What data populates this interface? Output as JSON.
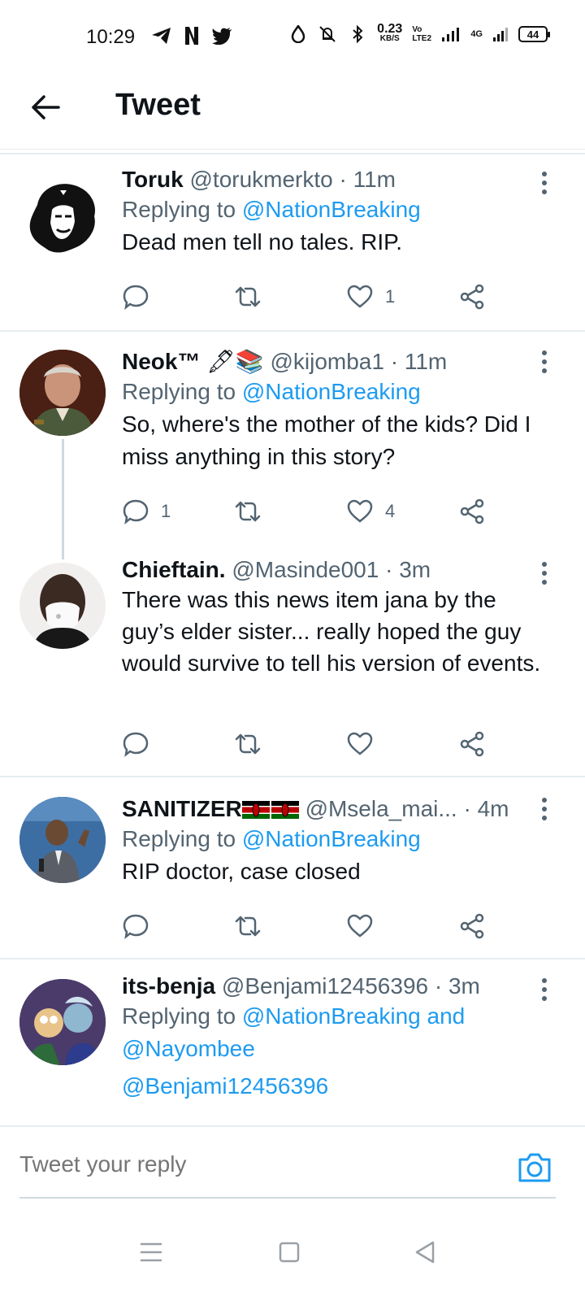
{
  "status_bar": {
    "time": "10:29",
    "speed_value": "0.23",
    "speed_unit": "KB/S",
    "volte": "Vo LTE2",
    "network": "4G",
    "battery": "44"
  },
  "header": {
    "title": "Tweet"
  },
  "tweets": [
    {
      "name": "Toruk",
      "handle": "@torukmerkto",
      "time": "· 11m",
      "reply_prefix": "Replying to ",
      "reply_to": "@NationBreaking",
      "text": "Dead men tell no tales. RIP.",
      "replies": "",
      "retweets": "",
      "likes": "1"
    },
    {
      "name": "Neok™",
      "emoji": "🖋📚",
      "handle": "@kijomba1",
      "time": "· 11m",
      "reply_prefix": "Replying to ",
      "reply_to": "@NationBreaking",
      "text": "So, where's the mother of the kids? Did I miss anything in this story?",
      "replies": "1",
      "retweets": "",
      "likes": "4"
    },
    {
      "name": "Chieftain.",
      "handle": "@Masinde001",
      "time": "· 3m",
      "text": "There was this news item jana by the guy’s elder sister... really hoped the guy would survive to tell his version of events.",
      "replies": "",
      "retweets": "",
      "likes": ""
    },
    {
      "name": "SANITIZER",
      "handle": "@Msela_mai...",
      "time": "· 4m",
      "reply_prefix": "Replying to ",
      "reply_to": "@NationBreaking",
      "text": "RIP doctor, case closed",
      "replies": "",
      "retweets": "",
      "likes": ""
    },
    {
      "name": "its-benja",
      "handle": "@Benjami12456396",
      "time": "· 3m",
      "reply_prefix": "Replying to ",
      "reply_to": "@NationBreaking and",
      "reply_to_2": "@Nayombee",
      "text": "@Benjami12456396"
    }
  ],
  "reply_bar": {
    "placeholder": "Tweet your reply"
  },
  "colors": {
    "link": "#1d9bf0",
    "muted": "#536471",
    "divider": "#e6ecf0"
  }
}
